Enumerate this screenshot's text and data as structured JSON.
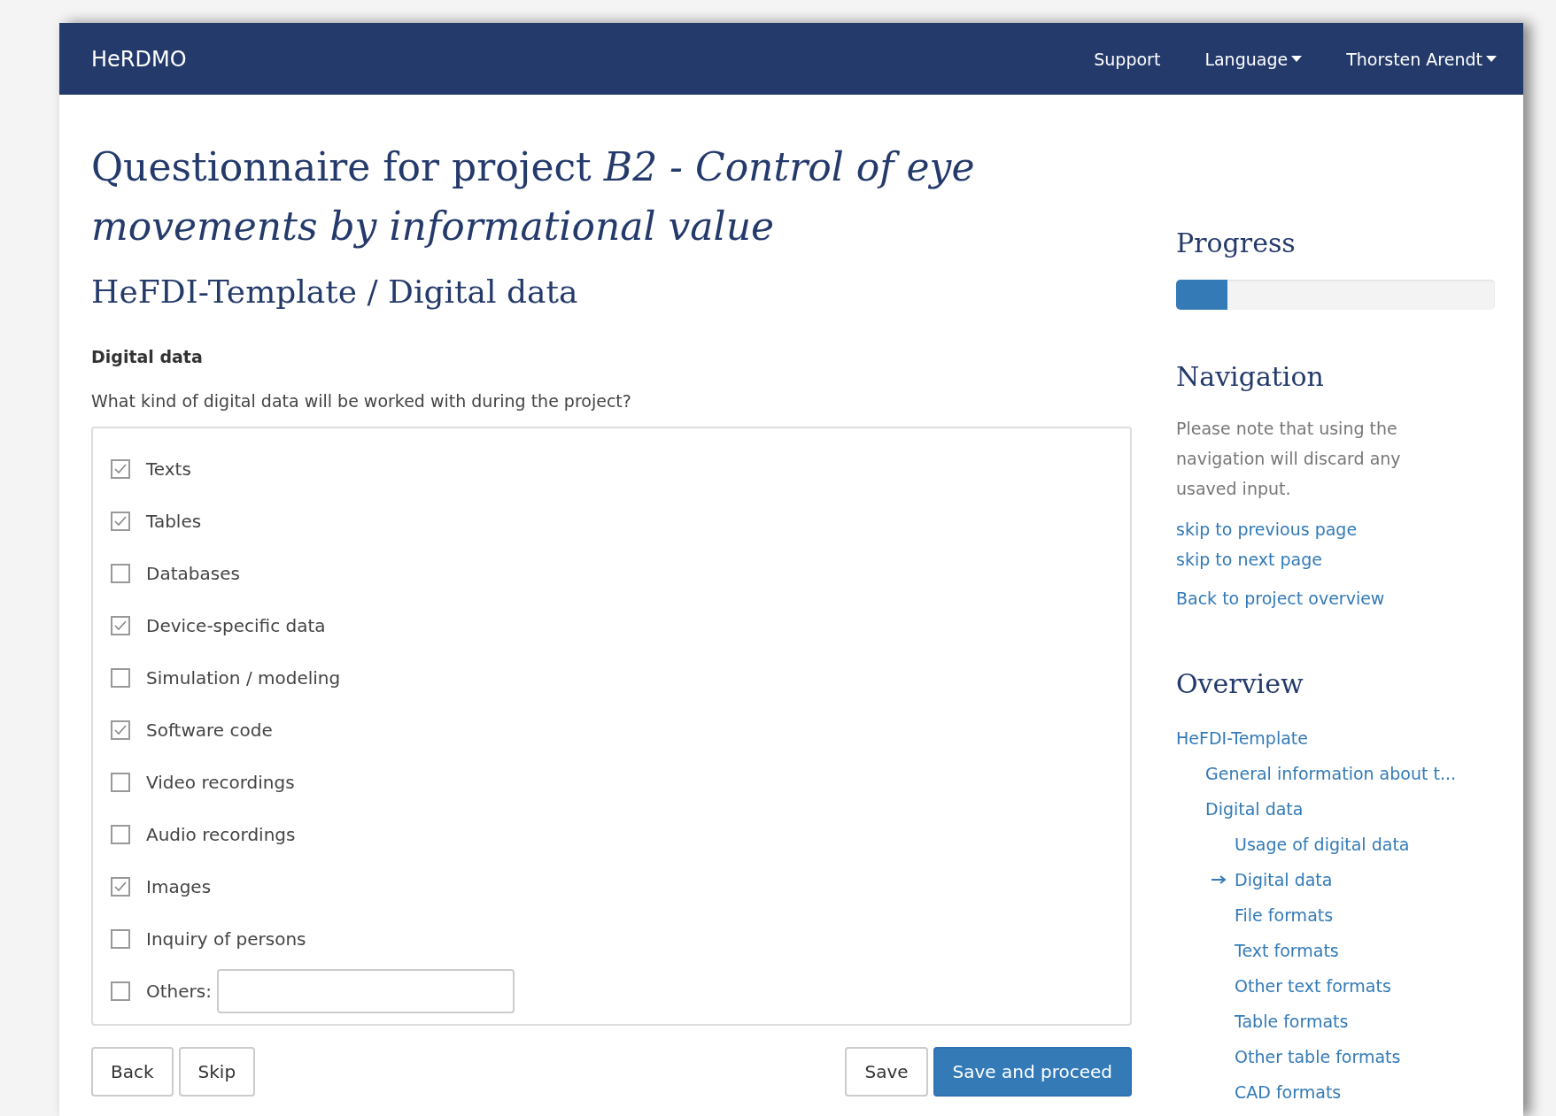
{
  "navbar": {
    "brand": "HeRDMO",
    "links": [
      {
        "label": "Support",
        "dropdown": false
      },
      {
        "label": "Language",
        "dropdown": true
      },
      {
        "label": "Thorsten Arendt",
        "dropdown": true
      }
    ]
  },
  "title": {
    "prefix": "Questionnaire for project ",
    "project": "B2 - Control of eye movements by informational value"
  },
  "subtitle": "HeFDI-Template / Digital data",
  "question": {
    "label": "Digital data",
    "text": "What kind of digital data will be worked with during the project?",
    "options": [
      {
        "label": "Texts",
        "checked": true
      },
      {
        "label": "Tables",
        "checked": true
      },
      {
        "label": "Databases",
        "checked": false
      },
      {
        "label": "Device-specific data",
        "checked": true
      },
      {
        "label": "Simulation / modeling",
        "checked": false
      },
      {
        "label": "Software code",
        "checked": true
      },
      {
        "label": "Video recordings",
        "checked": false
      },
      {
        "label": "Audio recordings",
        "checked": false
      },
      {
        "label": "Images",
        "checked": true
      },
      {
        "label": "Inquiry of persons",
        "checked": false
      },
      {
        "label": "Others:",
        "checked": false,
        "kind": "text_input"
      }
    ]
  },
  "buttons_left": [
    "Back",
    "Skip"
  ],
  "buttons_right": [
    {
      "label": "Save",
      "primary": false
    },
    {
      "label": "Save and proceed",
      "primary": true
    }
  ],
  "sidebar": {
    "progress": {
      "title": "Progress",
      "level": 0.16
    },
    "navigation": {
      "title": "Navigation",
      "note": "Please note that using the navigation will discard any usaved input.",
      "links": [
        "skip to previous page",
        "skip to next page"
      ],
      "back": "Back to project overview"
    },
    "overview": {
      "title": "Overview",
      "items": [
        {
          "label": "HeFDI-Template",
          "selected": false,
          "children": [
            {
              "label": "General information about t...",
              "selected": false
            },
            {
              "label": "Digital data",
              "selected": false,
              "children": [
                {
                  "label": "Usage of digital data",
                  "selected": false
                },
                {
                  "label": "Digital data",
                  "selected": true
                },
                {
                  "label": "File formats",
                  "selected": false
                },
                {
                  "label": "Text formats",
                  "selected": false
                },
                {
                  "label": "Other text formats",
                  "selected": false
                },
                {
                  "label": "Table formats",
                  "selected": false
                },
                {
                  "label": "Other table formats",
                  "selected": false
                },
                {
                  "label": "CAD formats",
                  "selected": false
                }
              ]
            }
          ]
        }
      ]
    }
  }
}
